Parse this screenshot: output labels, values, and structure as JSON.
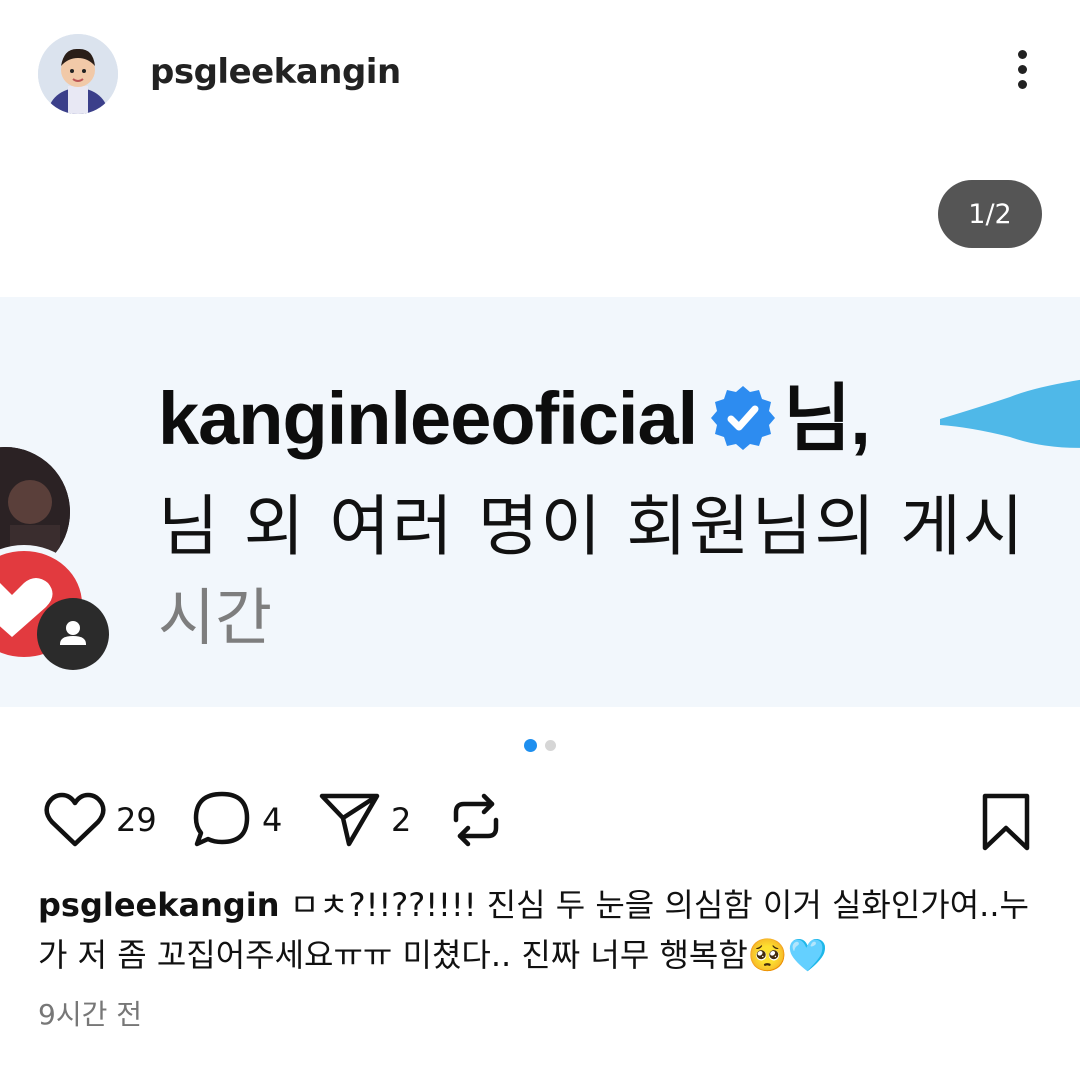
{
  "header": {
    "username": "psgleekangin"
  },
  "carousel": {
    "counter": "1/2",
    "page_count": 2,
    "active_index": 0
  },
  "post_image": {
    "line1_user": "kanginleeoficial",
    "line1_suffix": "님,",
    "line2": "님 외 여러 명이 회원님의 게시",
    "line3": "시간",
    "accent_color": "#1e8fef",
    "heart_badge_color": "#e23a3f"
  },
  "actions": {
    "likes": "29",
    "comments": "4",
    "shares": "2"
  },
  "caption": {
    "username": "psgleekangin",
    "text": "ㅁㅊ?!!??!!!! 진심 두 눈을 의심함 이거 실화인가여..누가 저 좀 꼬집어주세요ㅠㅠ 미쳤다.. 진짜 너무 행복함🥺🩵"
  },
  "timestamp": "9시간 전"
}
